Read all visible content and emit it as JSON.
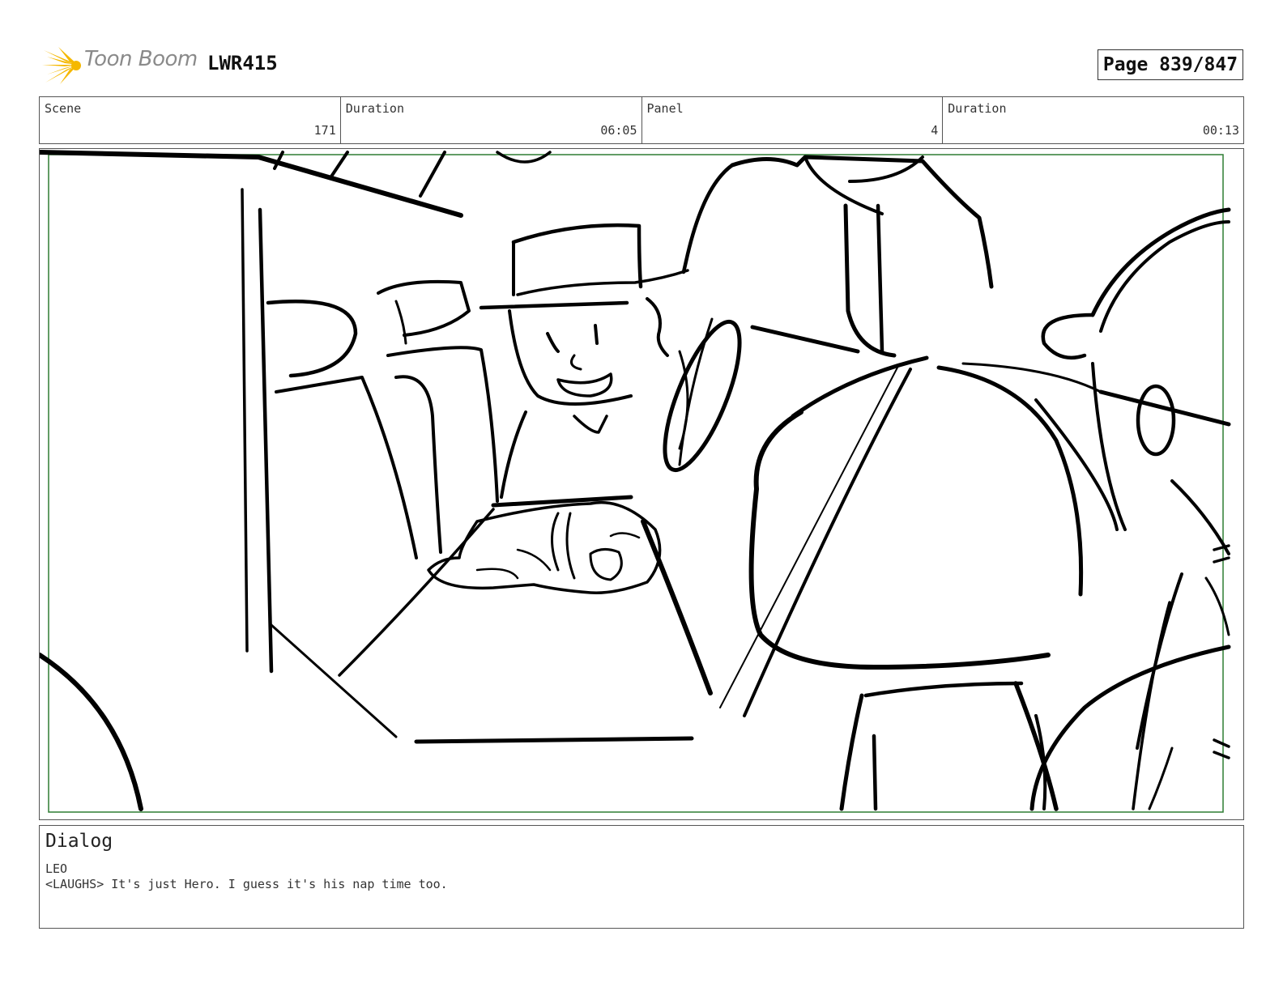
{
  "header": {
    "logo_text": "Toon Boom",
    "doc_code": "LWR415",
    "page_label": "Page 839/847"
  },
  "info": {
    "scene_label": "Scene",
    "scene_value": "171",
    "scene_duration_label": "Duration",
    "scene_duration_value": "06:05",
    "panel_label": "Panel",
    "panel_value": "4",
    "panel_duration_label": "Duration",
    "panel_duration_value": "00:13"
  },
  "dialog": {
    "title": "Dialog",
    "speaker": "LEO",
    "line": "<LAUGHS> It's just Hero. I guess it's his nap time too."
  },
  "colors": {
    "safe_frame": "#2e7d32",
    "logo_burst": "#f5b800",
    "ink": "#000000"
  }
}
